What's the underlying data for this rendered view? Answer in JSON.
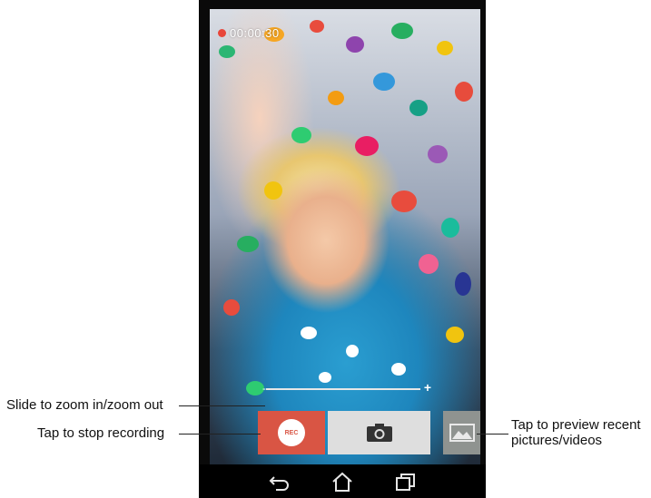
{
  "recording": {
    "timer": "00:00:30"
  },
  "zoom": {
    "minus": "-",
    "plus": "+"
  },
  "controls": {
    "rec_label": "REC"
  },
  "annotations": {
    "zoom": "Slide to zoom in/zoom out",
    "stop": "Tap to stop recording",
    "preview_line1": "Tap to preview recent",
    "preview_line2": "pictures/videos"
  },
  "colors": {
    "rec_red": "#d95544",
    "indicator_red": "#e8463a",
    "shutter_gray": "#dedede",
    "thumb_gray": "#8f9390"
  },
  "icons": [
    "camera-icon",
    "gallery-icon",
    "back-icon",
    "home-icon",
    "recent-apps-icon"
  ]
}
